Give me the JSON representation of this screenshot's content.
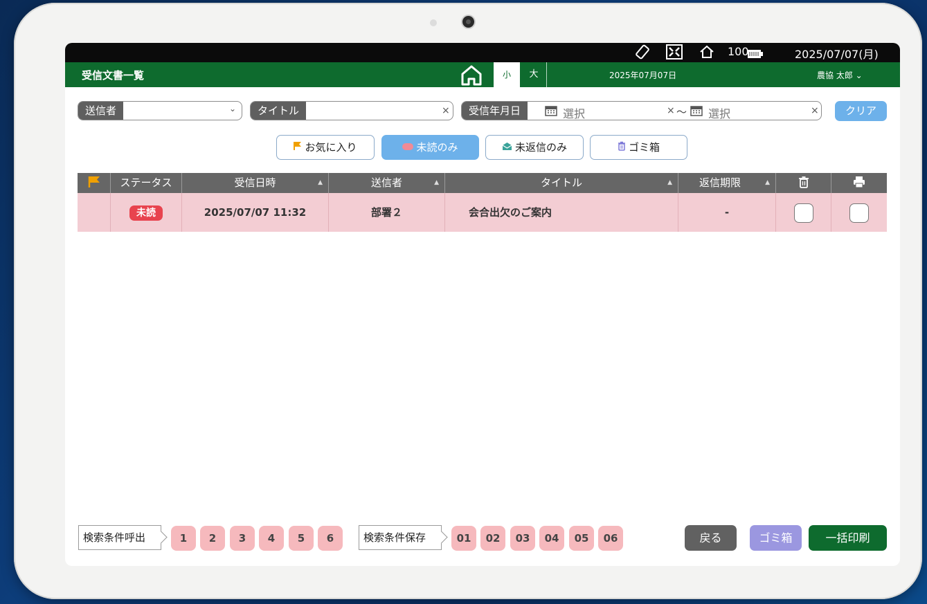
{
  "status_bar": {
    "battery": "100",
    "datetime": "2025/07/07(月)"
  },
  "app_bar": {
    "title": "受信文書一覧",
    "size_small": "小",
    "size_large": "大",
    "date": "2025年07月07日",
    "user": "農協 太郎",
    "user_caret": "⌄"
  },
  "filters": {
    "sender_label": "送信者",
    "sender_caret": "⌄",
    "title_label": "タイトル",
    "clear_x": "×",
    "date_label": "受信年月日",
    "date_from_placeholder": "選択",
    "date_to_placeholder": "選択",
    "tilde": "〜",
    "clear_button": "クリア"
  },
  "toggles": {
    "favorites": "お気に入り",
    "unread_only": "未読のみ",
    "unreplied_only": "未返信のみ",
    "trash": "ゴミ箱"
  },
  "table": {
    "headers": {
      "status": "ステータス",
      "received_at": "受信日時",
      "sender": "送信者",
      "title": "タイトル",
      "reply_deadline": "返信期限"
    },
    "sort_mark": "▲",
    "rows": [
      {
        "status": "未読",
        "received_at": "2025/07/07 11:32",
        "sender": "部署２",
        "title": "会合出欠のご案内",
        "reply_deadline": "-"
      }
    ]
  },
  "footer": {
    "load_label": "検索条件呼出",
    "load_slots": [
      "1",
      "2",
      "3",
      "4",
      "5",
      "6"
    ],
    "save_label": "検索条件保存",
    "save_slots": [
      "01",
      "02",
      "03",
      "04",
      "05",
      "06"
    ],
    "back_button": "戻る",
    "trash_button": "ゴミ箱",
    "bulk_print_button": "一括印刷"
  },
  "colors": {
    "app_bar": "#0e6b2e",
    "accent_blue": "#6db1ea",
    "unread_row": "#f3cdd3",
    "badge_red": "#e8434e",
    "slot_pink": "#f6b9bd",
    "trash_purple": "#9b97e0",
    "print_green": "#0e6b2e",
    "back_gray": "#616161"
  }
}
